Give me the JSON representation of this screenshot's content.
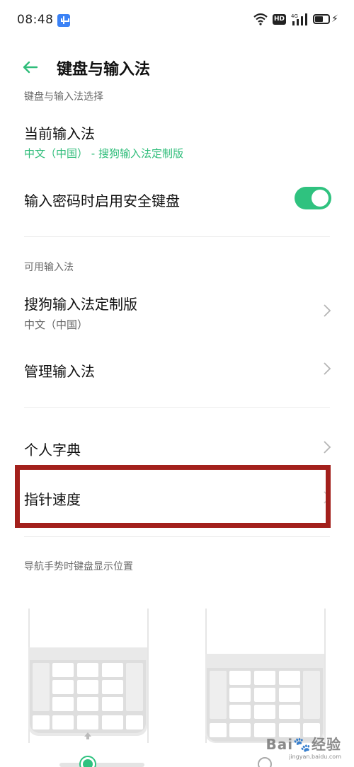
{
  "status_bar": {
    "time": "08:48",
    "icons": [
      "usb-icon",
      "wifi-icon",
      "hd-icon",
      "signal-4g-icon",
      "battery-charging-icon"
    ],
    "hd_label": "HD"
  },
  "header": {
    "back_icon": "arrow-left-icon",
    "title": "键盘与输入法"
  },
  "sections": {
    "selection_label": "键盘与输入法选择",
    "current_ime": {
      "title": "当前输入法",
      "value": "中文（中国） - 搜狗输入法定制版"
    },
    "secure_keyboard": {
      "title": "输入密码时启用安全键盘",
      "enabled": true
    },
    "available_label": "可用输入法",
    "sogou": {
      "title": "搜狗输入法定制版",
      "subtitle": "中文（中国）"
    },
    "manage": {
      "title": "管理输入法"
    },
    "dictionary": {
      "title": "个人字典"
    },
    "pointer_speed": {
      "title": "指针速度"
    },
    "nav_gesture_label": "导航手势时键盘显示位置"
  },
  "keyboard_position": {
    "selected_option": 0
  },
  "colors": {
    "accent": "#2fbd7a",
    "toggle_on": "#2fc27f",
    "highlight_border": "#a3201c"
  },
  "watermark": {
    "text": "Bai",
    "text2": "经验",
    "sub": "jingyan.baidu.com"
  }
}
